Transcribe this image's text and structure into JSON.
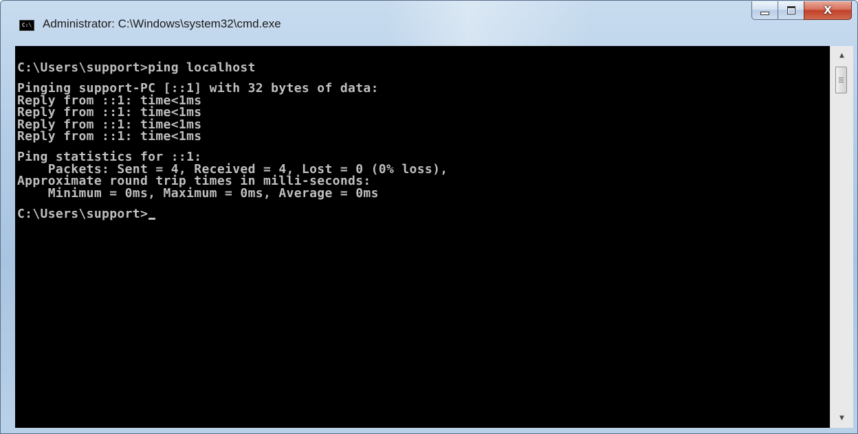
{
  "window": {
    "title": "Administrator: C:\\Windows\\system32\\cmd.exe",
    "icon": "cmd-icon",
    "icon_text": "C:\\",
    "controls": {
      "minimize": "minimize-icon",
      "maximize": "maximize-icon",
      "close": "close-icon",
      "close_glyph": "X"
    }
  },
  "console": {
    "foreground": "#c0c0c0",
    "background": "#000000",
    "lines": [
      "C:\\Users\\support>ping localhost",
      "",
      "Pinging support-PC [::1] with 32 bytes of data:",
      "Reply from ::1: time<1ms",
      "Reply from ::1: time<1ms",
      "Reply from ::1: time<1ms",
      "Reply from ::1: time<1ms",
      "",
      "Ping statistics for ::1:",
      "    Packets: Sent = 4, Received = 4, Lost = 0 (0% loss),",
      "Approximate round trip times in milli-seconds:",
      "    Minimum = 0ms, Maximum = 0ms, Average = 0ms",
      "",
      "C:\\Users\\support>"
    ]
  },
  "scrollbar": {
    "up_icon": "scroll-up-arrow-icon",
    "down_icon": "scroll-down-arrow-icon",
    "up_glyph": "▲",
    "down_glyph": "▼"
  }
}
